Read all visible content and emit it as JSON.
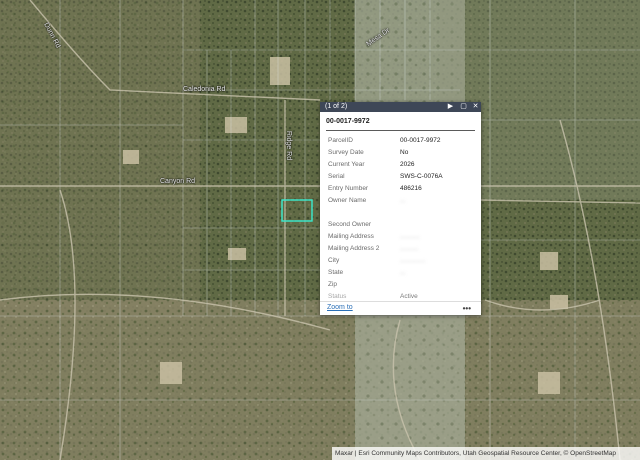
{
  "map": {
    "road_labels": [
      "Dunn Rd",
      "Caledonia Rd",
      "Canyon Rd",
      "Ridge Rd",
      "Mesa Dr"
    ],
    "selection_color": "#3ee6c8",
    "parcel_line_color": "#dfe6ea"
  },
  "popup": {
    "counter": "(1 of 2)",
    "next_icon": "triangle-right-icon",
    "dock_icon": "window-icon",
    "close_icon": "close-icon",
    "title": "00-0017-9972",
    "fields": [
      {
        "label": "ParcelID",
        "value": "00-0017-9972",
        "hidden": false
      },
      {
        "label": "Survey Date",
        "value": "No",
        "hidden": false
      },
      {
        "label": "Current Year",
        "value": "2026",
        "hidden": false
      },
      {
        "label": "Serial",
        "value": "SWS-C-0076A",
        "hidden": false
      },
      {
        "label": "Entry Number",
        "value": "486216",
        "hidden": false
      },
      {
        "label": "Owner Name",
        "value": "...",
        "hidden": true
      },
      {
        "label": "",
        "value": "",
        "hidden": true
      },
      {
        "label": "Second Owner",
        "value": "",
        "hidden": true
      },
      {
        "label": "Mailing Address",
        "value": "...........",
        "hidden": true
      },
      {
        "label": "Mailing Address 2",
        "value": "..........",
        "hidden": true
      },
      {
        "label": "City",
        "value": "..............",
        "hidden": true
      },
      {
        "label": "State",
        "value": "...",
        "hidden": true
      },
      {
        "label": "Zip",
        "value": "",
        "hidden": false
      },
      {
        "label": "Status",
        "value": "Active",
        "hidden": false
      }
    ],
    "zoom_label": "Zoom to",
    "more_label": "•••"
  },
  "attribution": "Maxar | Esri Community Maps Contributors, Utah Geospatial Resource Center, © OpenStreetMap"
}
